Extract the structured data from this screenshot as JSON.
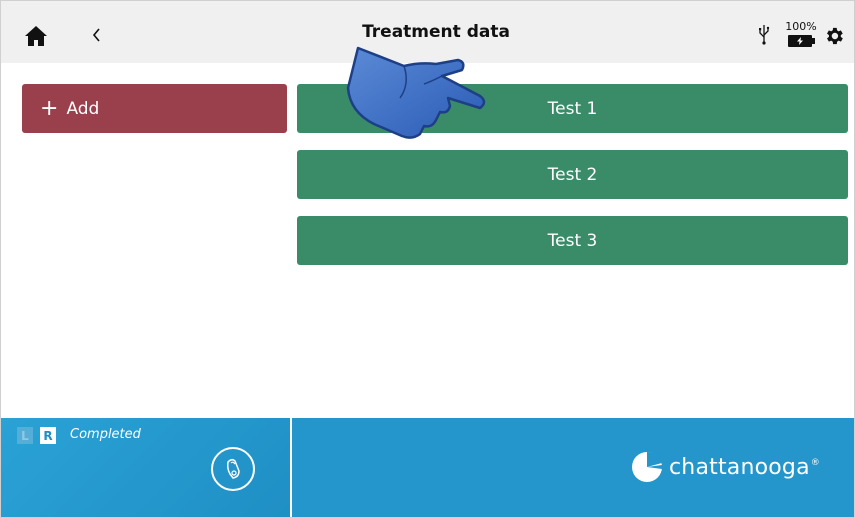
{
  "header": {
    "title": "Treatment data",
    "battery_percent": "100%",
    "icons": [
      "home-icon",
      "chevron-left-icon",
      "usb-icon",
      "battery-charging-icon",
      "gear-icon"
    ]
  },
  "actions": {
    "add_symbol": "+",
    "add_label": "Add"
  },
  "tests": [
    {
      "label": "Test 1"
    },
    {
      "label": "Test 2"
    },
    {
      "label": "Test 3"
    }
  ],
  "footer": {
    "side_left": "L",
    "side_right": "R",
    "status": "Completed",
    "brand": "chattanooga",
    "brand_mark": "®"
  },
  "colors": {
    "add_button": "#9a404d",
    "test_button": "#3a8c68",
    "footer": "#2596cb",
    "header": "#f0f0f0"
  }
}
